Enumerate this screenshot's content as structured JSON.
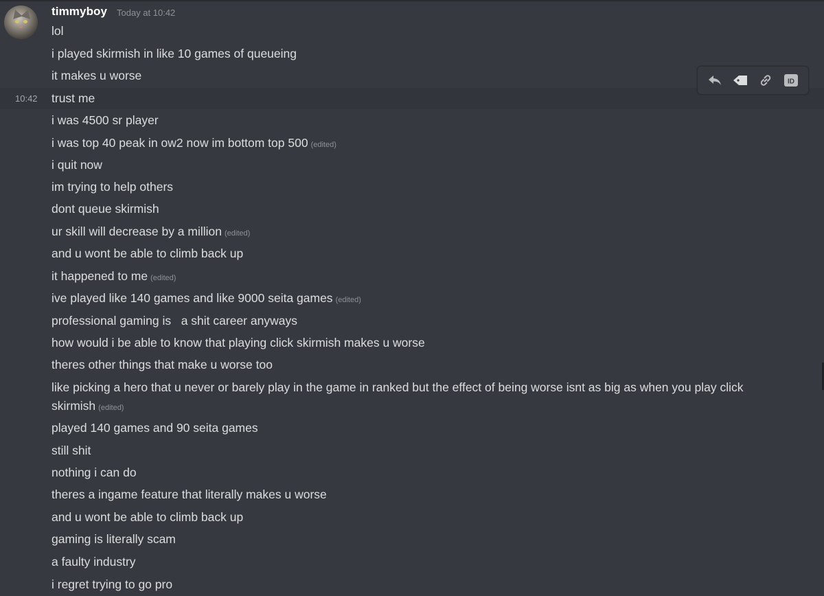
{
  "message_group": {
    "author": "timmyboy",
    "timestamp": "Today at 10:42",
    "hover_time": "10:42",
    "avatar_icon": "cat-avatar",
    "edited_label": "(edited)",
    "messages": [
      {
        "text": "lol",
        "edited": false
      },
      {
        "text": "i played skirmish in like 10 games of queueing",
        "edited": false
      },
      {
        "text": "it makes u worse",
        "edited": false
      },
      {
        "text": "trust me",
        "edited": false
      },
      {
        "text": "i was 4500 sr player",
        "edited": false
      },
      {
        "text": "i was top 40 peak in ow2 now im bottom top 500",
        "edited": true
      },
      {
        "text": "i quit now",
        "edited": false
      },
      {
        "text": "im trying to help others",
        "edited": false
      },
      {
        "text": "dont queue skirmish",
        "edited": false
      },
      {
        "text": "ur skill will decrease by a million",
        "edited": true
      },
      {
        "text": "and u wont be able to climb back up",
        "edited": false
      },
      {
        "text": "it happened to me",
        "edited": true
      },
      {
        "text": "ive played like 140 games and like 9000 seita games",
        "edited": true
      },
      {
        "text": "professional gaming is   a shit career anyways",
        "edited": false
      },
      {
        "text": "how would i be able to know that playing click skirmish makes u worse",
        "edited": false
      },
      {
        "text": "theres other things that make u worse too",
        "edited": false
      },
      {
        "text": "like picking a hero that u never or barely play in the game in ranked but the effect of being worse isnt as big as when you play click skirmish",
        "edited": true
      },
      {
        "text": "played 140 games and 90 seita games",
        "edited": false
      },
      {
        "text": "still shit",
        "edited": false
      },
      {
        "text": "nothing i can do",
        "edited": false
      },
      {
        "text": "theres a ingame feature that literally makes u worse",
        "edited": false
      },
      {
        "text": "and u wont be able to climb back up",
        "edited": false
      },
      {
        "text": "gaming is literally scam",
        "edited": false
      },
      {
        "text": "a faulty industry",
        "edited": false
      },
      {
        "text": "i regret trying to go pro",
        "edited": false
      }
    ]
  },
  "toolbar": {
    "buttons": [
      {
        "name": "reply-icon"
      },
      {
        "name": "tag-icon"
      },
      {
        "name": "link-icon"
      },
      {
        "name": "id-icon",
        "label": "ID"
      }
    ]
  },
  "colors": {
    "background": "#36393f",
    "text": "#dcddde",
    "muted": "#8e9297",
    "hover": "#32353b"
  }
}
